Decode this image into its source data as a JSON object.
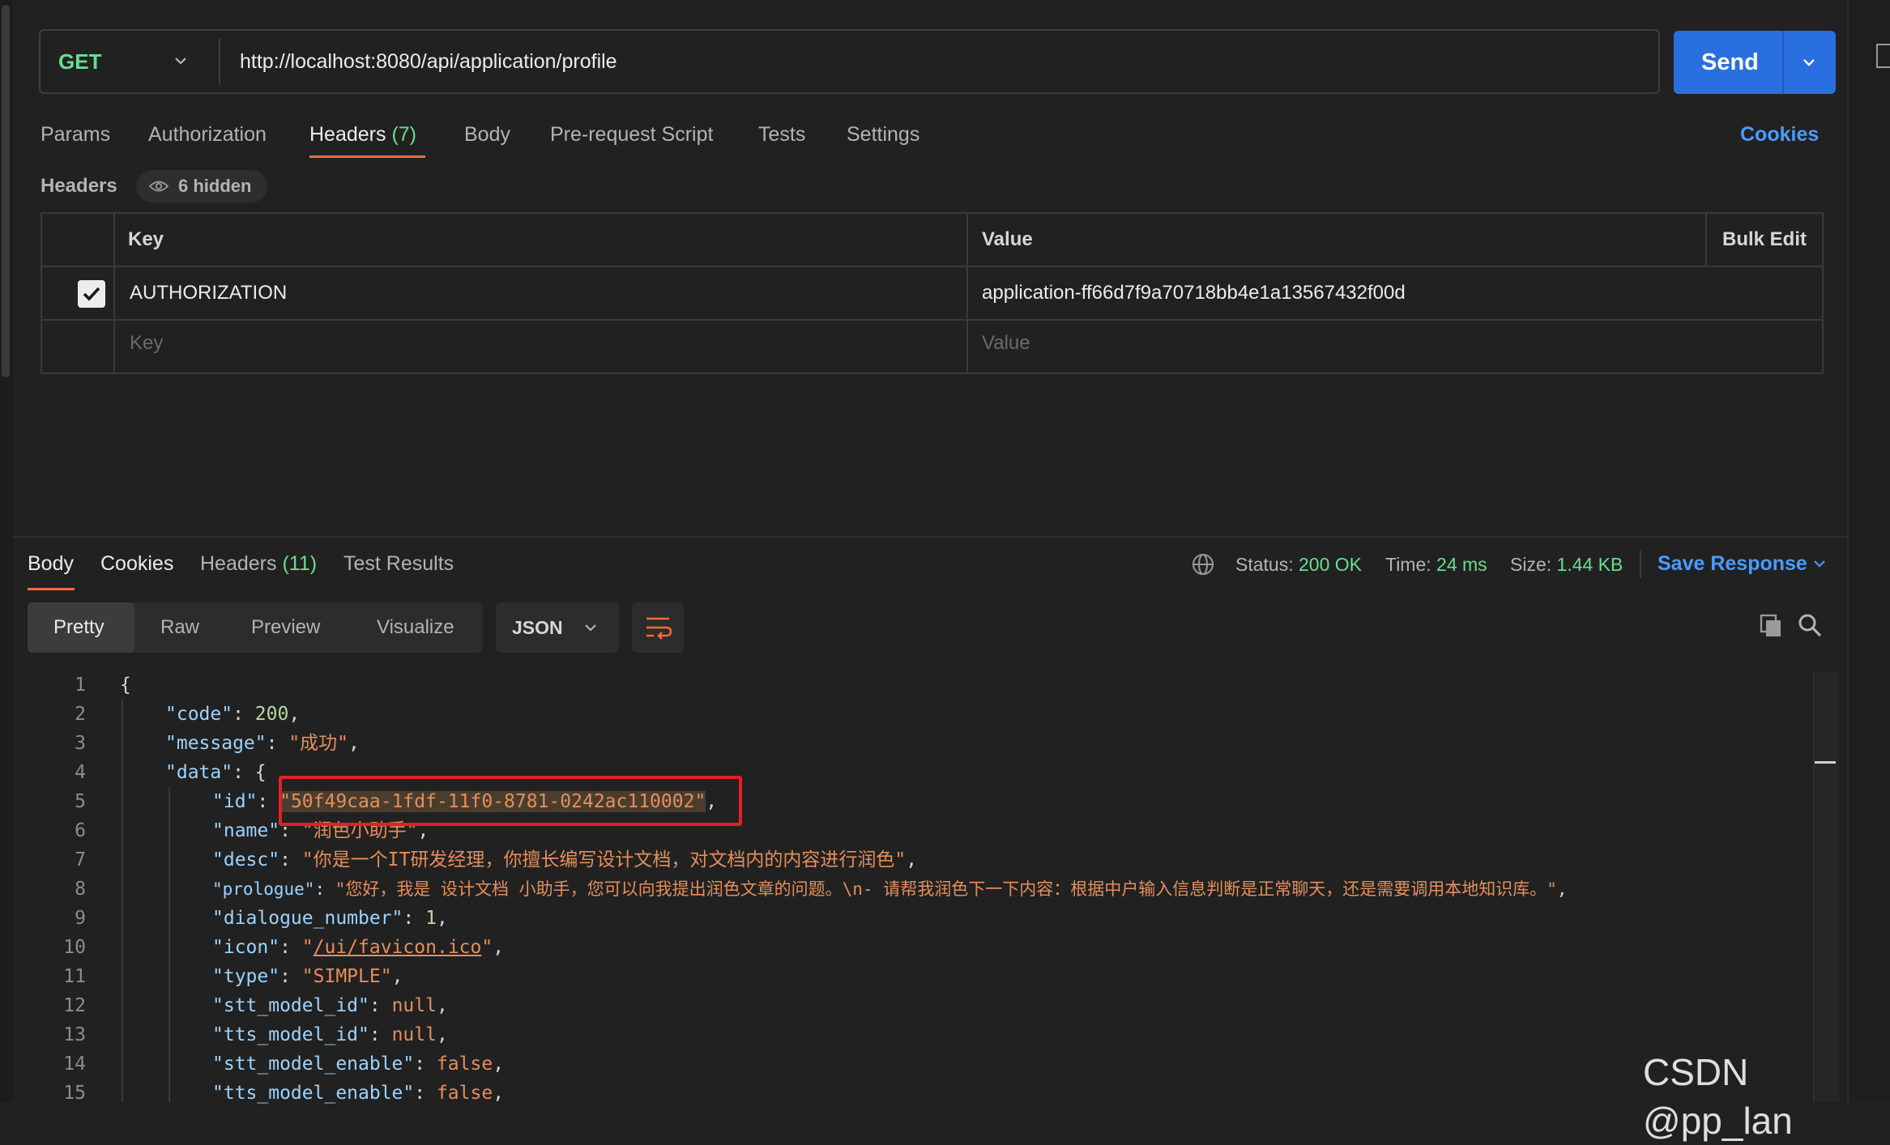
{
  "request": {
    "method": "GET",
    "url": "http://localhost:8080/api/application/profile",
    "send_label": "Send"
  },
  "request_tabs": {
    "params": "Params",
    "authorization": "Authorization",
    "headers": "Headers",
    "headers_count": "(7)",
    "body": "Body",
    "pre_request": "Pre-request Script",
    "tests": "Tests",
    "settings": "Settings",
    "cookies": "Cookies"
  },
  "headers_section": {
    "title": "Headers",
    "hidden": "6 hidden",
    "col_key": "Key",
    "col_value": "Value",
    "bulk_edit": "Bulk Edit",
    "rows": [
      {
        "checked": true,
        "key": "AUTHORIZATION",
        "value": "application-ff66d7f9a70718bb4e1a13567432f00d"
      }
    ],
    "key_placeholder": "Key",
    "value_placeholder": "Value"
  },
  "response": {
    "tabs": {
      "body": "Body",
      "cookies": "Cookies",
      "headers": "Headers",
      "headers_count": "(11)",
      "test_results": "Test Results"
    },
    "status_label": "Status:",
    "status_value": "200 OK",
    "time_label": "Time:",
    "time_value": "24 ms",
    "size_label": "Size:",
    "size_value": "1.44 KB",
    "save_response": "Save Response",
    "views": {
      "pretty": "Pretty",
      "raw": "Raw",
      "preview": "Preview",
      "visualize": "Visualize"
    },
    "format": "JSON",
    "code": {
      "l1": "{",
      "l2k": "\"code\"",
      "l2v": "200",
      "l3k": "\"message\"",
      "l3v": "\"成功\"",
      "l4k": "\"data\"",
      "l4v": "{",
      "l5k": "\"id\"",
      "l5v": "\"50f49caa-1fdf-11f0-8781-0242ac110002\"",
      "l6k": "\"name\"",
      "l6v": "\"润色小助手\"",
      "l7k": "\"desc\"",
      "l7v": "\"你是一个IT研发经理，你擅长编写设计文档，对文档内的内容进行润色\"",
      "l8k": "\"prologue\"",
      "l8v": "\"您好，我是 设计文档 小助手，您可以向我提出润色文章的问题。\\n- 请帮我润色下一下内容：根据中户输入信息判断是正常聊天，还是需要调用本地知识库。\"",
      "l9k": "\"dialogue_number\"",
      "l9v": "1",
      "l10k": "\"icon\"",
      "l10v": "/ui/favicon.ico",
      "l11k": "\"type\"",
      "l11v": "\"SIMPLE\"",
      "l12k": "\"stt_model_id\"",
      "l12v": "null",
      "l13k": "\"tts_model_id\"",
      "l13v": "null",
      "l14k": "\"stt_model_enable\"",
      "l14v": "false",
      "l15k": "\"tts_model_enable\"",
      "l15v": "false"
    },
    "line_numbers": [
      "1",
      "2",
      "3",
      "4",
      "5",
      "6",
      "7",
      "8",
      "9",
      "10",
      "11",
      "12",
      "13",
      "14",
      "15"
    ]
  },
  "watermark": "CSDN @pp_lan"
}
